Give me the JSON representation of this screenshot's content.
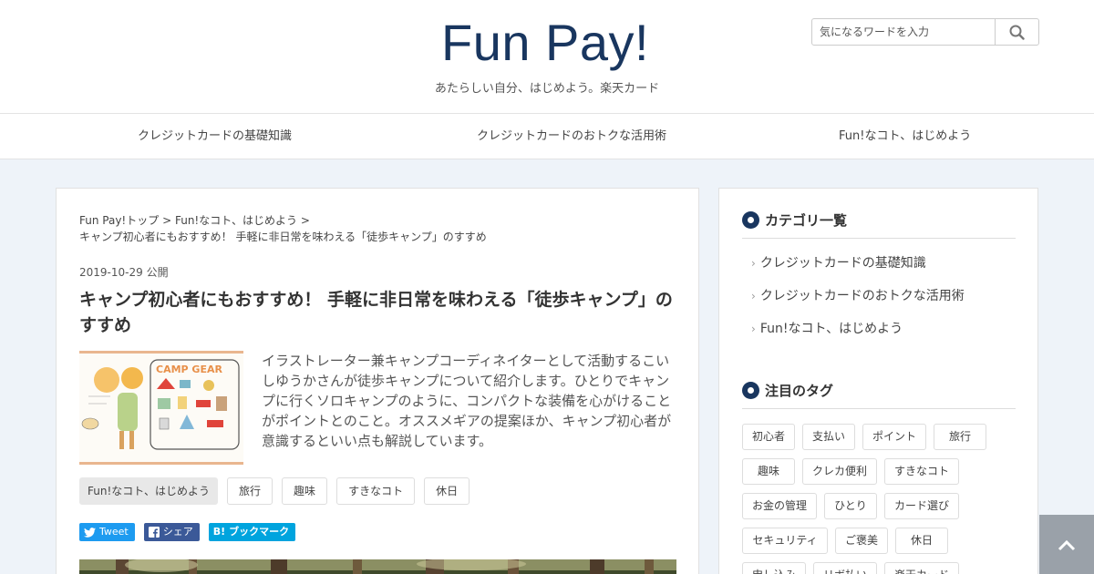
{
  "header": {
    "logo": "Fun Pay!",
    "tagline": "あたらしい自分、はじめよう。楽天カード",
    "search": {
      "placeholder": "気になるワードを入力"
    }
  },
  "nav": {
    "items": [
      {
        "label": "クレジットカードの基礎知識"
      },
      {
        "label": "クレジットカードのおトクな活用術"
      },
      {
        "label": "Fun!なコト、はじめよう"
      }
    ]
  },
  "article": {
    "breadcrumb": {
      "home": "Fun Pay!トップ",
      "separator": ">",
      "category": "Fun!なコト、はじめよう",
      "current": "キャンプ初心者にもおすすめ！ 手軽に非日常を味わえる「徒歩キャンプ」のすすめ"
    },
    "date": "2019-10-29",
    "date_suffix": "公開",
    "title": "キャンプ初心者にもおすすめ！ 手軽に非日常を味わえる「徒歩キャンプ」のすすめ",
    "excerpt": "イラストレーター兼キャンプコーディネイターとして活動するこいしゆうかさんが徒歩キャンプについて紹介します。ひとりでキャンプに行くソロキャンプのように、コンパクトな装備を心がけることがポイントとのこと。オススメギアの提案ほか、キャンプ初心者が意識するといい点も解説しています。",
    "thumbnail_text": "CAMP GEAR",
    "category_tag": "Fun!なコト、はじめよう",
    "tags": [
      "旅行",
      "趣味",
      "すきなコト",
      "休日"
    ],
    "share": {
      "tweet": "Tweet",
      "facebook": "シェア",
      "hatena": "ブックマーク",
      "hatena_mark": "B!"
    }
  },
  "sidebar": {
    "categories_heading": "カテゴリ一覧",
    "categories": [
      {
        "label": "クレジットカードの基礎知識"
      },
      {
        "label": "クレジットカードのおトクな活用術"
      },
      {
        "label": "Fun!なコト、はじめよう"
      }
    ],
    "tags_heading": "注目のタグ",
    "tags": [
      "初心者",
      "支払い",
      "ポイント",
      "旅行",
      "趣味",
      "クレカ便利",
      "すきなコト",
      "お金の管理",
      "ひとり",
      "カード選び",
      "セキュリティ",
      "ご褒美",
      "休日",
      "申し込み",
      "リボ払い",
      "楽天カード"
    ]
  },
  "colors": {
    "brand": "#19365f",
    "background": "#eef3f9",
    "twitter": "#1d9bf0",
    "facebook": "#3b5998",
    "hatena": "#00a4de"
  }
}
